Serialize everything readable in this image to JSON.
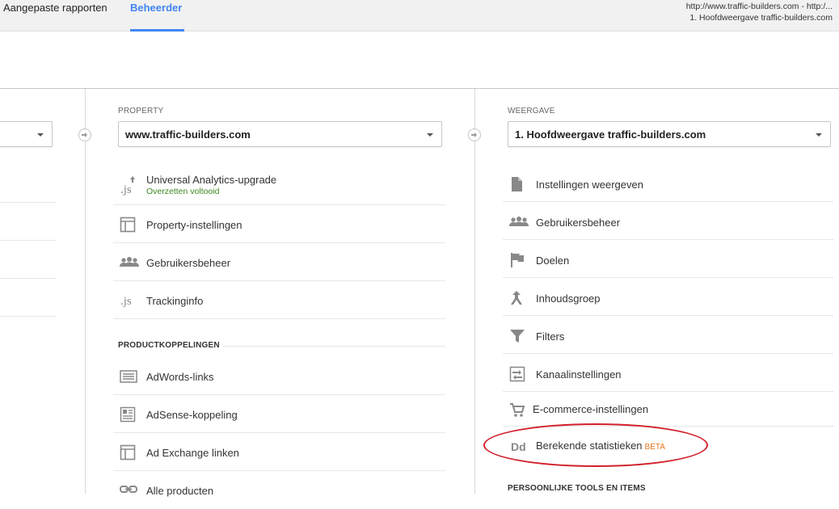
{
  "header": {
    "tabs": [
      {
        "label": "Aangepaste rapporten"
      },
      {
        "label": "Beheerder"
      }
    ],
    "account_url": "http://www.traffic-builders.com - http:/...",
    "account_view": "1. Hoofdweergave traffic-builders.com"
  },
  "property": {
    "label": "PROPERTY",
    "selected": "www.traffic-builders.com",
    "items": [
      {
        "label": "Universal Analytics-upgrade",
        "sublabel": "Overzetten voltooid",
        "icon": "js-upgrade-icon"
      },
      {
        "label": "Property-instellingen",
        "icon": "property-icon"
      },
      {
        "label": "Gebruikersbeheer",
        "icon": "users-icon"
      },
      {
        "label": "Trackinginfo",
        "icon": "js-icon"
      }
    ],
    "section_title": "PRODUCTKOPPELINGEN",
    "links": [
      {
        "label": "AdWords-links",
        "icon": "adwords-icon"
      },
      {
        "label": "AdSense-koppeling",
        "icon": "adsense-icon"
      },
      {
        "label": "Ad Exchange linken",
        "icon": "ad-exchange-icon"
      },
      {
        "label": "Alle producten",
        "icon": "link-icon"
      }
    ]
  },
  "view": {
    "label": "WEERGAVE",
    "selected": "1. Hoofdweergave traffic-builders.com",
    "items": [
      {
        "label": "Instellingen weergeven",
        "icon": "document-icon"
      },
      {
        "label": "Gebruikersbeheer",
        "icon": "users-icon"
      },
      {
        "label": "Doelen",
        "icon": "flag-icon"
      },
      {
        "label": "Inhoudsgroep",
        "icon": "content-group-icon"
      },
      {
        "label": "Filters",
        "icon": "filter-icon"
      },
      {
        "label": "Kanaalinstellingen",
        "icon": "channel-icon"
      },
      {
        "label": "E-commerce-instellingen",
        "icon": "cart-icon"
      },
      {
        "label": "Berekende statistieken",
        "badge": "BETA",
        "icon": "dd-icon"
      }
    ],
    "section_title": "PERSOONLIJKE TOOLS EN ITEMS"
  },
  "colors": {
    "accent": "#4285f4",
    "success": "#3a8a1e",
    "beta": "#e5761c",
    "highlight": "#d2202a"
  }
}
